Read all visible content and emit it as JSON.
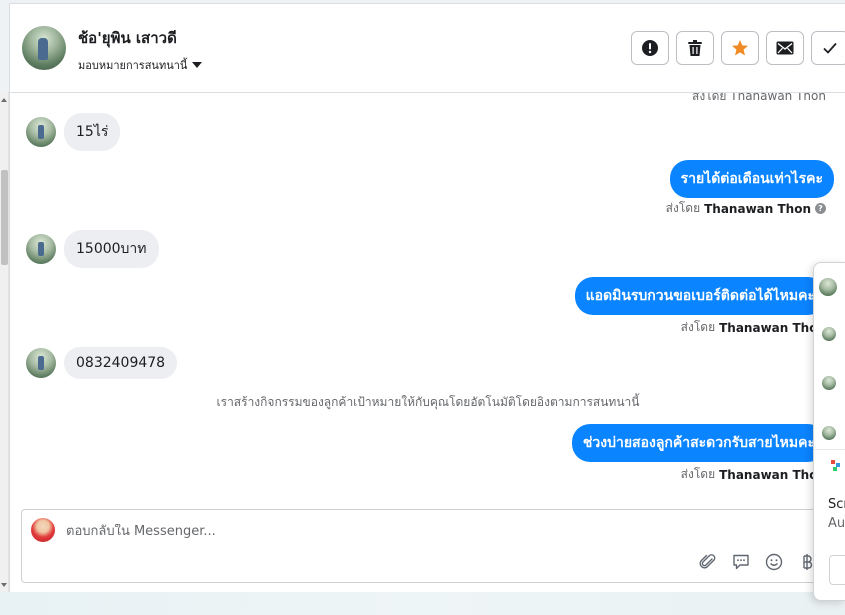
{
  "header": {
    "contact_name": "ช้อ'ยุพิน เสาวดี",
    "assign_label": "มอบหมายการสนทนานี้",
    "actions": [
      {
        "name": "spam-button",
        "icon": "exclamation-circle-icon"
      },
      {
        "name": "delete-button",
        "icon": "trash-icon"
      },
      {
        "name": "star-button",
        "icon": "star-icon"
      },
      {
        "name": "mark-unread-button",
        "icon": "envelope-icon"
      },
      {
        "name": "done-button",
        "icon": "checkmark-icon"
      }
    ]
  },
  "messages": {
    "cutoff_sender": "ส่งโดย Thanawan Thon",
    "in1": "15ไร่",
    "out1": "รายได้ต่อเดือนเท่าไรคะ",
    "sent_prefix": "ส่งโดย",
    "sent_name": "Thanawan Thon",
    "in2": "15000บาท",
    "out2": "แอดมินรบกวนขอเบอร์ติดต่อได้ไหมคะ",
    "in3": "0832409478",
    "system_note": "เราสร้างกิจกรรมของลูกค้าเป้าหมายให้กับคุณโดยอัตโนมัติโดยอิงตามการสนทนานี้",
    "out3": "ช่วงบ่ายสองลูกค้าสะดวกรับสายไหมคะ"
  },
  "composer": {
    "placeholder": "ตอบกลับใน Messenger..."
  },
  "floating_panel": {
    "text_line1": "Scr",
    "text_line2": "Au"
  },
  "colors": {
    "outgoing_bubble": "#0b84ff",
    "incoming_bubble": "#eceef1",
    "star": "#f08a24"
  }
}
